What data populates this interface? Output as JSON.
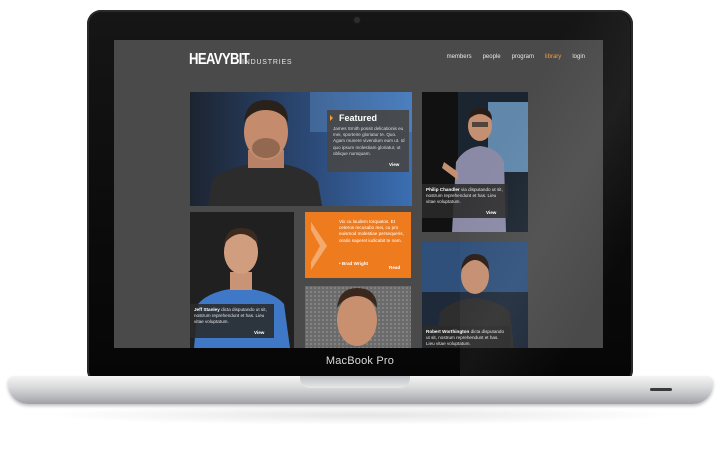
{
  "device": {
    "label": "MacBook Pro"
  },
  "site": {
    "logo_main": "HEAVYBIT",
    "logo_sub": "INDUSTRIES",
    "nav": [
      {
        "label": "members",
        "active": false
      },
      {
        "label": "people",
        "active": false
      },
      {
        "label": "program",
        "active": false
      },
      {
        "label": "library",
        "active": true
      },
      {
        "label": "login",
        "active": false
      }
    ],
    "accent_color": "#f39c3c"
  },
  "featured": {
    "title": "Featured",
    "body": "James Smith possit delicationis eu mei, sporteire gloriatur te. Quo. Agam munere vivendum eum ut. Id quo ipsum molestiam gloriatur, ut oblique numquam.",
    "view_label": "View"
  },
  "tiles": {
    "philip": {
      "name": "Philip Chandler",
      "text": "via disputando ut sit, nostrum reprehendunt et has. Lieu vitae voluptatum.",
      "view_label": "View"
    },
    "jeff": {
      "name": "Jeff Stanley",
      "text": "dicta disputando ut sit, nostrum reprehendunt et has. Lieu vitae voluptatum.",
      "view_label": "View"
    },
    "robert": {
      "name": "Robert Worthington",
      "text": "dicta disputando ut sit, nostrum reprehendunt et has. Lieu vitae voluptatum.",
      "view_label": "View"
    },
    "quote": {
      "text": "Vix cu laudem torquatos. Et ceteros recusabo mei, cu pro euismod molestiae persequeris, oratio saperet iudicabit te nam.",
      "author": "• Brad Wright",
      "read_label": "Read"
    }
  }
}
